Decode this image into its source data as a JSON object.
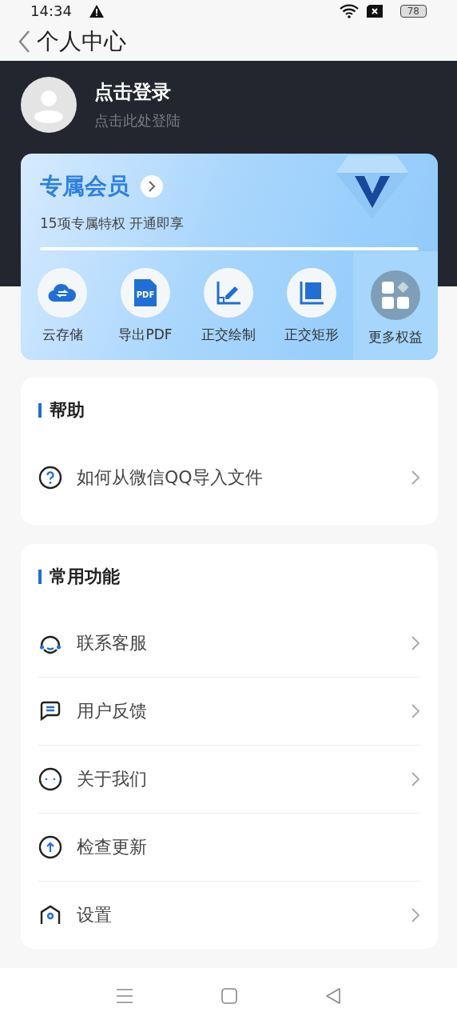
{
  "status_bar": {
    "time": "14:34",
    "battery": "78"
  },
  "header": {
    "title": "个人中心"
  },
  "profile": {
    "name": "点击登录",
    "hint": "点击此处登陆"
  },
  "membership": {
    "title": "专属会员",
    "subtitle": "15项专属特权 开通即享",
    "features": [
      {
        "kind": "cloud",
        "label": "云存储"
      },
      {
        "kind": "pdf",
        "label": "导出PDF",
        "badge": "PDF"
      },
      {
        "kind": "draw",
        "label": "正交绘制"
      },
      {
        "kind": "rect",
        "label": "正交矩形"
      }
    ],
    "more": {
      "label": "更多权益"
    }
  },
  "sections": [
    {
      "title": "帮助",
      "rows": [
        {
          "kind": "question",
          "label": "如何从微信QQ导入文件",
          "chevron": true
        }
      ]
    },
    {
      "title": "常用功能",
      "rows": [
        {
          "kind": "headset",
          "label": "联系客服",
          "chevron": true
        },
        {
          "kind": "chat",
          "label": "用户反馈",
          "chevron": true
        },
        {
          "kind": "face",
          "label": "关于我们",
          "chevron": true
        },
        {
          "kind": "upload",
          "label": "检查更新",
          "chevron": false
        },
        {
          "kind": "settings",
          "label": "设置",
          "chevron": true
        }
      ]
    }
  ]
}
